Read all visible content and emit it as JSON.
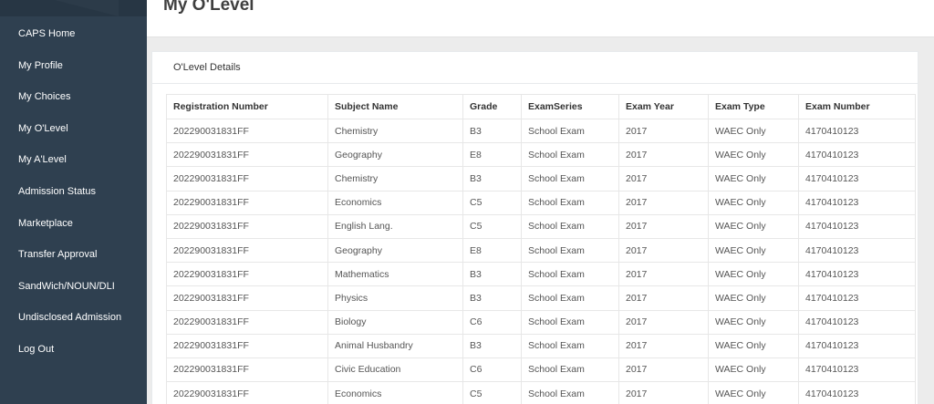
{
  "sidebar": {
    "items": [
      {
        "label": "CAPS Home"
      },
      {
        "label": "My Profile"
      },
      {
        "label": "My Choices"
      },
      {
        "label": "My O'Level"
      },
      {
        "label": "My A'Level"
      },
      {
        "label": "Admission Status"
      },
      {
        "label": "Marketplace"
      },
      {
        "label": "Transfer Approval"
      },
      {
        "label": "SandWich/NOUN/DLI"
      },
      {
        "label": "Undisclosed Admission"
      },
      {
        "label": "Log Out"
      }
    ]
  },
  "page": {
    "title": "My O'Level"
  },
  "panel": {
    "title": "O'Level Details"
  },
  "table": {
    "headers": [
      "Registration Number",
      "Subject Name",
      "Grade",
      "ExamSeries",
      "Exam Year",
      "Exam Type",
      "Exam Number"
    ],
    "rows": [
      [
        "202290031831FF",
        "Chemistry",
        "B3",
        "School Exam",
        "2017",
        "WAEC Only",
        "4170410123"
      ],
      [
        "202290031831FF",
        "Geography",
        "E8",
        "School Exam",
        "2017",
        "WAEC Only",
        "4170410123"
      ],
      [
        "202290031831FF",
        "Chemistry",
        "B3",
        "School Exam",
        "2017",
        "WAEC Only",
        "4170410123"
      ],
      [
        "202290031831FF",
        "Economics",
        "C5",
        "School Exam",
        "2017",
        "WAEC Only",
        "4170410123"
      ],
      [
        "202290031831FF",
        "English Lang.",
        "C5",
        "School Exam",
        "2017",
        "WAEC Only",
        "4170410123"
      ],
      [
        "202290031831FF",
        "Geography",
        "E8",
        "School Exam",
        "2017",
        "WAEC Only",
        "4170410123"
      ],
      [
        "202290031831FF",
        "Mathematics",
        "B3",
        "School Exam",
        "2017",
        "WAEC Only",
        "4170410123"
      ],
      [
        "202290031831FF",
        "Physics",
        "B3",
        "School Exam",
        "2017",
        "WAEC Only",
        "4170410123"
      ],
      [
        "202290031831FF",
        "Biology",
        "C6",
        "School Exam",
        "2017",
        "WAEC Only",
        "4170410123"
      ],
      [
        "202290031831FF",
        "Animal Husbandry",
        "B3",
        "School Exam",
        "2017",
        "WAEC Only",
        "4170410123"
      ],
      [
        "202290031831FF",
        "Civic Education",
        "C6",
        "School Exam",
        "2017",
        "WAEC Only",
        "4170410123"
      ],
      [
        "202290031831FF",
        "Economics",
        "C5",
        "School Exam",
        "2017",
        "WAEC Only",
        "4170410123"
      ]
    ]
  },
  "colors": {
    "sidebar_bg": "#2f4050",
    "page_bg": "#ececec"
  }
}
